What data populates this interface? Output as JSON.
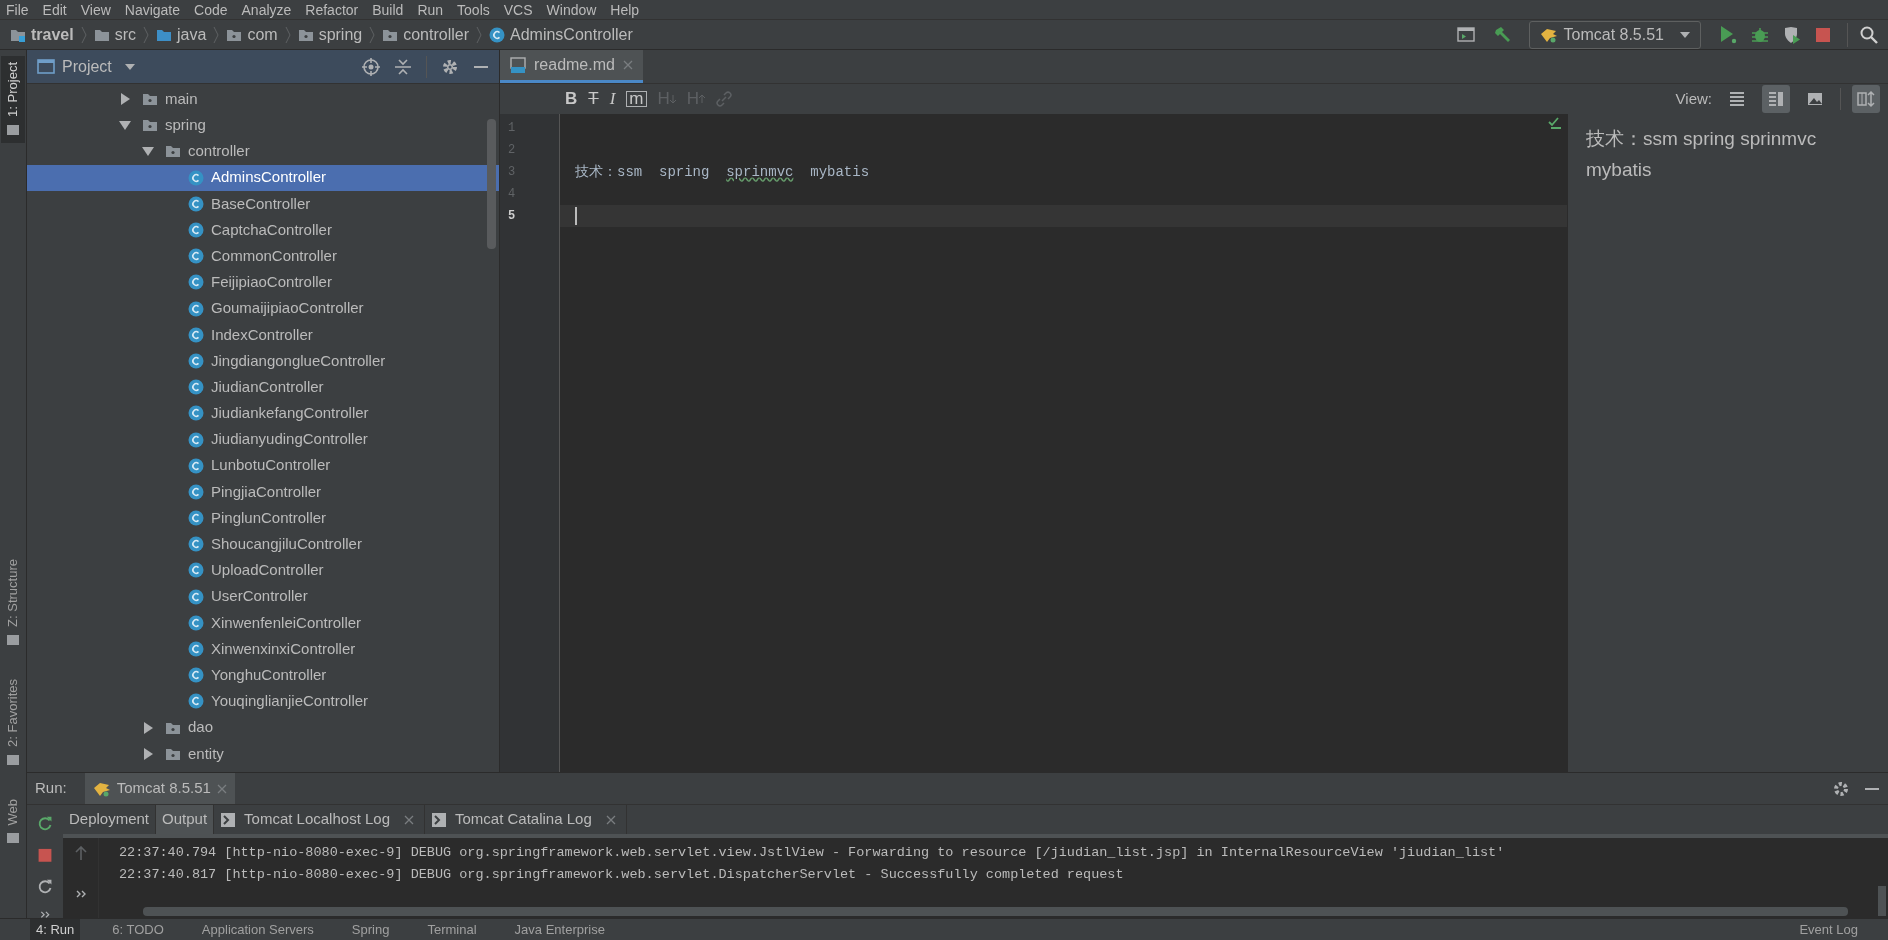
{
  "menu": [
    "File",
    "Edit",
    "View",
    "Navigate",
    "Code",
    "Analyze",
    "Refactor",
    "Build",
    "Run",
    "Tools",
    "VCS",
    "Window",
    "Help"
  ],
  "breadcrumbs": [
    {
      "label": "travel",
      "kind": "project"
    },
    {
      "label": "src",
      "kind": "folder"
    },
    {
      "label": "java",
      "kind": "source"
    },
    {
      "label": "com",
      "kind": "package"
    },
    {
      "label": "spring",
      "kind": "package"
    },
    {
      "label": "controller",
      "kind": "package"
    },
    {
      "label": "AdminsController",
      "kind": "class"
    }
  ],
  "run_config": "Tomcat 8.5.51",
  "left_stripe": [
    {
      "label": "1: Project",
      "selected": true,
      "kind": "project"
    },
    {
      "label": "Z: Structure",
      "selected": false,
      "kind": "structure"
    },
    {
      "label": "2: Favorites",
      "selected": false,
      "kind": "favorites"
    },
    {
      "label": "Web",
      "selected": false,
      "kind": "web"
    }
  ],
  "project_panel": {
    "title": "Project",
    "tree": [
      {
        "label": "main",
        "kind": "folder",
        "expanded": false,
        "selected": false
      },
      {
        "label": "spring",
        "kind": "folder",
        "expanded": true,
        "selected": false,
        "children": [
          {
            "label": "controller",
            "kind": "folder",
            "expanded": true,
            "selected": false,
            "children": [
              {
                "label": "AdminsController",
                "kind": "class",
                "selected": true
              },
              {
                "label": "BaseController",
                "kind": "abstract_class",
                "selected": false
              },
              {
                "label": "CaptchaController",
                "kind": "class",
                "selected": false
              },
              {
                "label": "CommonController",
                "kind": "class",
                "selected": false
              },
              {
                "label": "FeijipiaoController",
                "kind": "class",
                "selected": false
              },
              {
                "label": "GoumaijipiaoController",
                "kind": "class",
                "selected": false
              },
              {
                "label": "IndexController",
                "kind": "class",
                "selected": false
              },
              {
                "label": "JingdiangonglueController",
                "kind": "class",
                "selected": false
              },
              {
                "label": "JiudianController",
                "kind": "class",
                "selected": false
              },
              {
                "label": "JiudiankefangController",
                "kind": "class",
                "selected": false
              },
              {
                "label": "JiudianyudingController",
                "kind": "class",
                "selected": false
              },
              {
                "label": "LunbotuController",
                "kind": "class",
                "selected": false
              },
              {
                "label": "PingjiaController",
                "kind": "class",
                "selected": false
              },
              {
                "label": "PinglunController",
                "kind": "class",
                "selected": false
              },
              {
                "label": "ShoucangjiluController",
                "kind": "class",
                "selected": false
              },
              {
                "label": "UploadController",
                "kind": "class",
                "selected": false
              },
              {
                "label": "UserController",
                "kind": "class",
                "selected": false
              },
              {
                "label": "XinwenfenleiController",
                "kind": "class",
                "selected": false
              },
              {
                "label": "XinwenxinxiController",
                "kind": "class",
                "selected": false
              },
              {
                "label": "YonghuController",
                "kind": "class",
                "selected": false
              },
              {
                "label": "YouqinglianjieController",
                "kind": "class",
                "selected": false
              }
            ]
          },
          {
            "label": "dao",
            "kind": "folder",
            "expanded": false,
            "selected": false
          },
          {
            "label": "entity",
            "kind": "folder",
            "expanded": false,
            "selected": false
          }
        ]
      }
    ]
  },
  "editor": {
    "tabs": [
      {
        "label": "readme.md",
        "selected": true
      }
    ],
    "format_buttons": [
      {
        "label": "B",
        "kind": "bold",
        "disabled": false
      },
      {
        "label": "T",
        "kind": "strike",
        "disabled": false
      },
      {
        "label": "I",
        "kind": "italic",
        "disabled": false
      },
      {
        "label": "m",
        "kind": "code",
        "disabled": false
      },
      {
        "label": "H",
        "kind": "header_down",
        "disabled": true
      },
      {
        "label": "H",
        "kind": "header_up",
        "disabled": true
      }
    ],
    "view_label": "View:",
    "view_modes": [
      {
        "selected": false
      },
      {
        "selected": true
      },
      {
        "selected": false
      }
    ],
    "scroll_sync": {
      "on": true
    },
    "lines": [
      {
        "number": "1",
        "current": false
      },
      {
        "number": "2",
        "current": false
      },
      {
        "number": "3",
        "current": false,
        "tokens": [
          {
            "text": "技术：ssm  spring  "
          },
          {
            "text": "sprinmvc",
            "typo": true
          },
          {
            "text": "  mybatis"
          }
        ]
      },
      {
        "number": "4",
        "current": false
      },
      {
        "number": "5",
        "current": true
      }
    ],
    "preview": "技术：ssm spring sprinmvc mybatis"
  },
  "run_panel": {
    "label": "Run:",
    "tab": "Tomcat 8.5.51",
    "subtabs": [
      {
        "label": "Deployment",
        "selected": false,
        "kind": "plain"
      },
      {
        "label": "Output",
        "selected": true,
        "kind": "plain"
      },
      {
        "label": "Tomcat Localhost Log",
        "selected": false,
        "kind": "log"
      },
      {
        "label": "Tomcat Catalina Log",
        "selected": false,
        "kind": "log"
      }
    ],
    "console": [
      "22:37:40.794 [http-nio-8080-exec-9] DEBUG org.springframework.web.servlet.view.JstlView - Forwarding to resource [/jiudian_list.jsp] in InternalResourceView 'jiudian_list'",
      "22:37:40.817 [http-nio-8080-exec-9] DEBUG org.springframework.web.servlet.DispatcherServlet - Successfully completed request"
    ]
  },
  "bottom_bar": {
    "left": [
      {
        "label": "4: Run",
        "selected": true
      },
      {
        "label": "6: TODO",
        "selected": false
      },
      {
        "label": "Application Servers",
        "selected": false
      },
      {
        "label": "Spring",
        "selected": false
      },
      {
        "label": "Terminal",
        "selected": false
      },
      {
        "label": "Java Enterprise",
        "selected": false
      }
    ],
    "right": "Event Log"
  }
}
